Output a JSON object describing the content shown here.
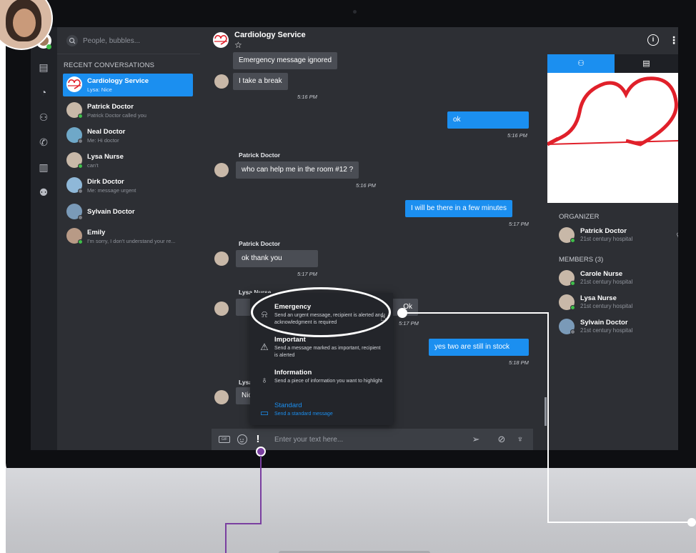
{
  "search": {
    "placeholder": "People, bubbles..."
  },
  "sidebar": {
    "heading": "RECENT CONVERSATIONS",
    "items": [
      {
        "name": "Cardiology Service",
        "sub": "Lysa: Nice",
        "active": true
      },
      {
        "name": "Patrick Doctor",
        "sub": "Patrick Doctor called you"
      },
      {
        "name": "Neal Doctor",
        "sub": "Me: Hi doctor"
      },
      {
        "name": "Lysa Nurse",
        "sub": "can't"
      },
      {
        "name": "Dirk Doctor",
        "sub": "Me: message urgent"
      },
      {
        "name": "Sylvain Doctor",
        "sub": ""
      },
      {
        "name": "Emily",
        "sub": "I'm sorry, I don't understand your re..."
      }
    ]
  },
  "chat": {
    "title": "Cardiology Service",
    "star": "☆",
    "messages": [
      {
        "text": "Emergency message ignored"
      },
      {
        "text": "I take a break",
        "time": "5:16 PM"
      },
      {
        "text": "ok",
        "time": "5:16 PM"
      },
      {
        "sender": "Patrick Doctor",
        "text": "who can help me in the room #12 ?",
        "time": "5:16 PM"
      },
      {
        "text": "I will be there in a few minutes",
        "time": "5:17 PM"
      },
      {
        "sender": "Patrick Doctor",
        "text": "ok thank you",
        "time": "5:17 PM"
      },
      {
        "sender": "Lysa Nurse",
        "text": "Ok",
        "time": "5:17 PM"
      },
      {
        "text": "yes two are still in stock",
        "time": "5:18 PM"
      },
      {
        "sender": "Lysa",
        "text": "Nice"
      }
    ],
    "composer": {
      "placeholder": "Enter your text here...",
      "urgency": "!",
      "gif": "GIF"
    }
  },
  "urgency_menu": [
    {
      "title": "Emergency",
      "desc": "Send an urgent message, recipient is alerted and acknowledgment is required"
    },
    {
      "title": "Important",
      "desc": "Send a message marked as important, recipient is alerted"
    },
    {
      "title": "Information",
      "desc": "Send a piece of information you want to highlight"
    },
    {
      "title": "Standard",
      "desc": "Send a standard message"
    }
  ],
  "rpanel": {
    "info": "i",
    "organizer_heading": "ORGANIZER",
    "organizer": {
      "name": "Patrick Doctor",
      "org": "21st century hospital"
    },
    "members_heading": "MEMBERS (3)",
    "members": [
      {
        "name": "Carole Nurse",
        "org": "21st century hospital"
      },
      {
        "name": "Lysa Nurse",
        "org": "21st century hospital"
      },
      {
        "name": "Sylvain Doctor",
        "org": "21st century hospital"
      }
    ]
  },
  "colors": {
    "accent": "#1b8ff0",
    "online": "#3fbf4a",
    "heart": "#e0202a",
    "callout": "#7a3fa0"
  },
  "icons": [
    "search-icon",
    "gif-icon",
    "smile-icon",
    "send-icon",
    "attach-icon",
    "mic-icon",
    "info-icon",
    "more-icon",
    "crown-icon",
    "star-icon",
    "heart-icon",
    "alarm-icon",
    "warning-icon",
    "bulb-icon",
    "chat-icon"
  ]
}
